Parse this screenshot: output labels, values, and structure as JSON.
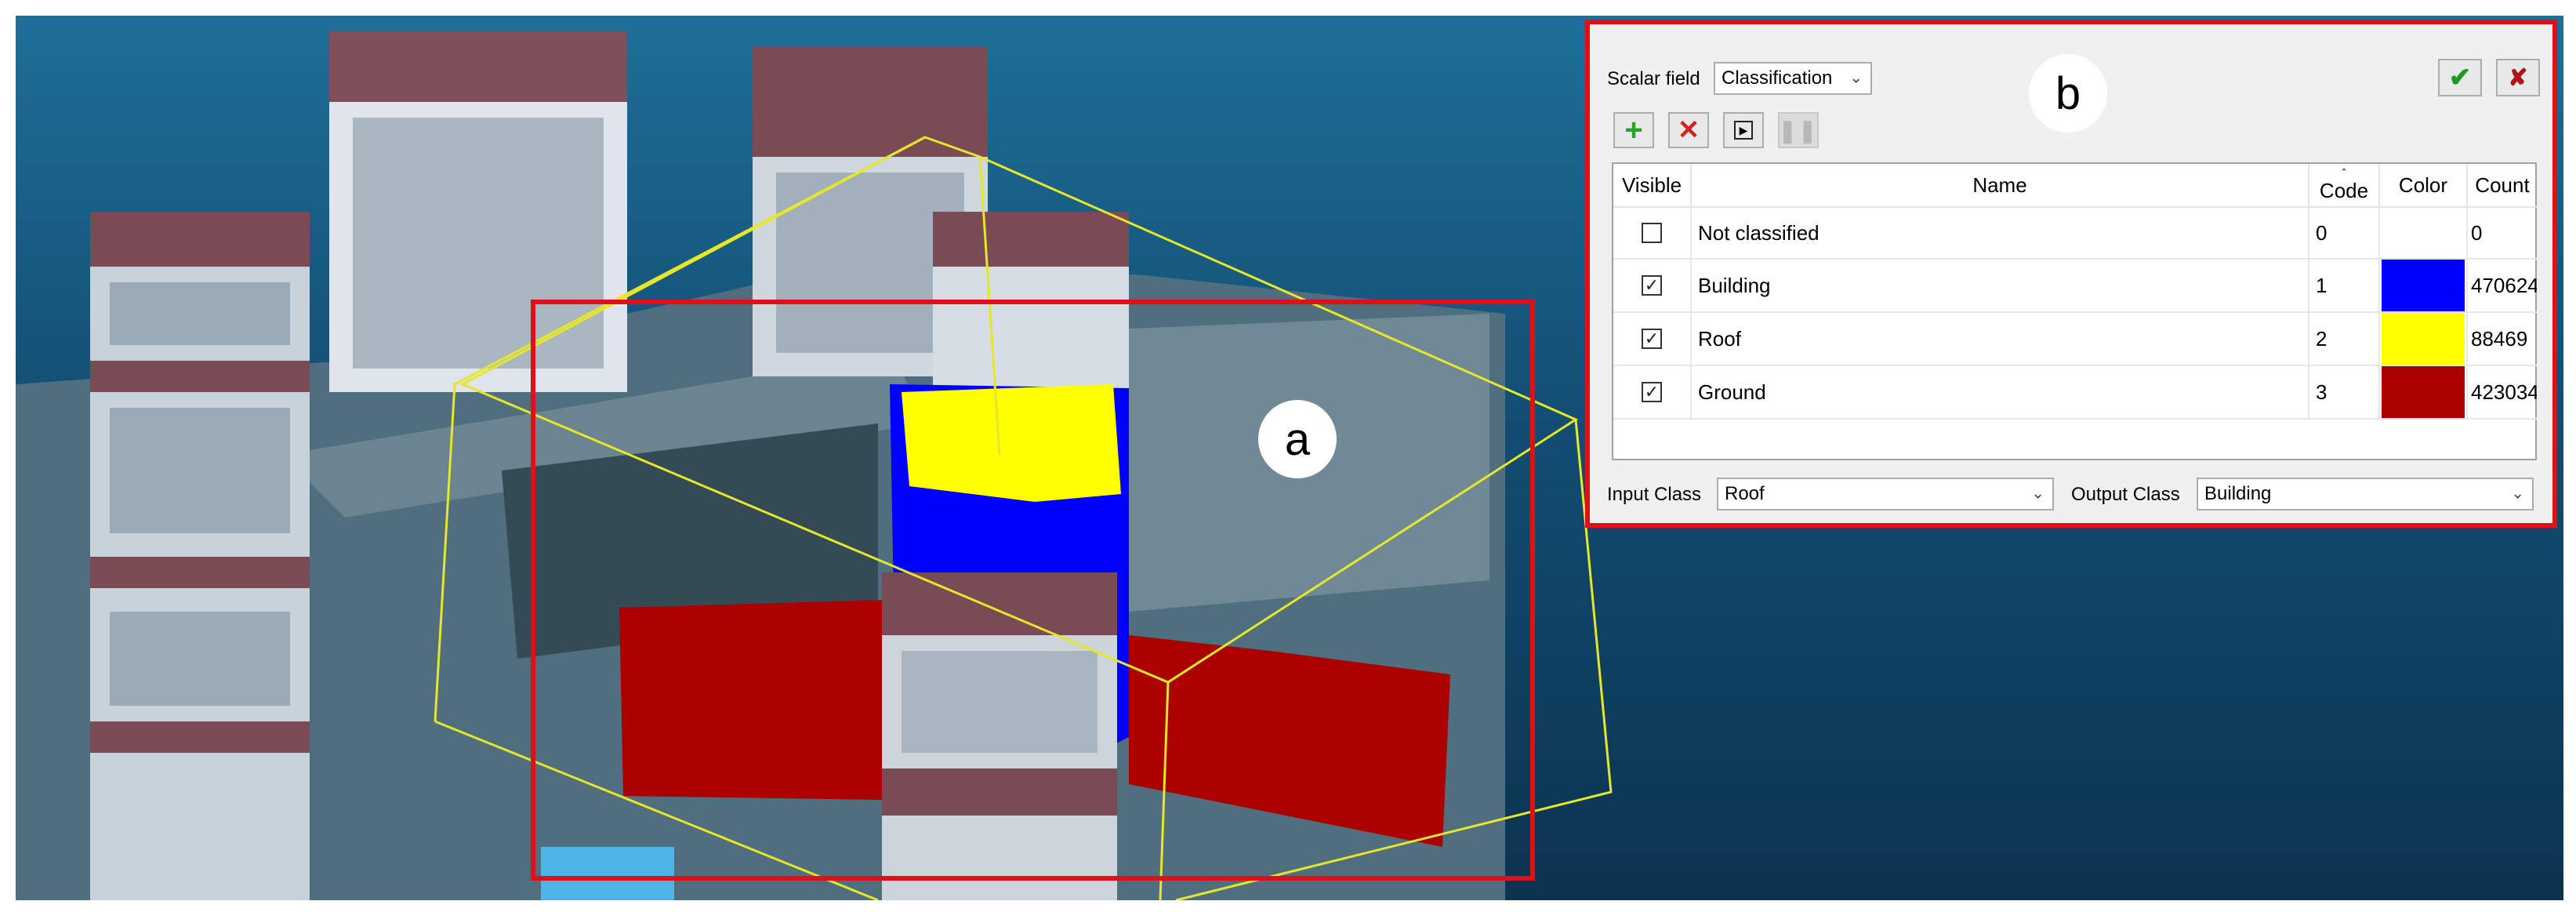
{
  "markers": {
    "a": "a",
    "b": "b"
  },
  "dialog": {
    "scalar_field_label": "Scalar field",
    "scalar_field_value": "Classification",
    "apply_icon": "checkmark-icon",
    "close_icon": "close-x-icon",
    "toolbar_icons": [
      "plus-icon",
      "delete-x-icon",
      "play-icon",
      "pause-icon"
    ],
    "table": {
      "headers": {
        "visible": "Visible",
        "name": "Name",
        "code": "Code",
        "color": "Color",
        "count": "Count"
      },
      "rows": [
        {
          "visible": false,
          "name": "Not classified",
          "code": "0",
          "color": "",
          "count": "0"
        },
        {
          "visible": true,
          "name": "Building",
          "code": "1",
          "color": "#0000ff",
          "count": "470624"
        },
        {
          "visible": true,
          "name": "Roof",
          "code": "2",
          "color": "#ffff00",
          "count": "88469"
        },
        {
          "visible": true,
          "name": "Ground",
          "code": "3",
          "color": "#aa0000",
          "count": "423034"
        }
      ]
    },
    "input_class_label": "Input Class",
    "input_class_value": "Roof",
    "output_class_label": "Output Class",
    "output_class_value": "Building"
  },
  "colors": {
    "highlight_border": "#e0101a",
    "selection_box": "#e6e62a",
    "building": "#0000ff",
    "roof": "#ffff00",
    "ground": "#aa0000"
  }
}
